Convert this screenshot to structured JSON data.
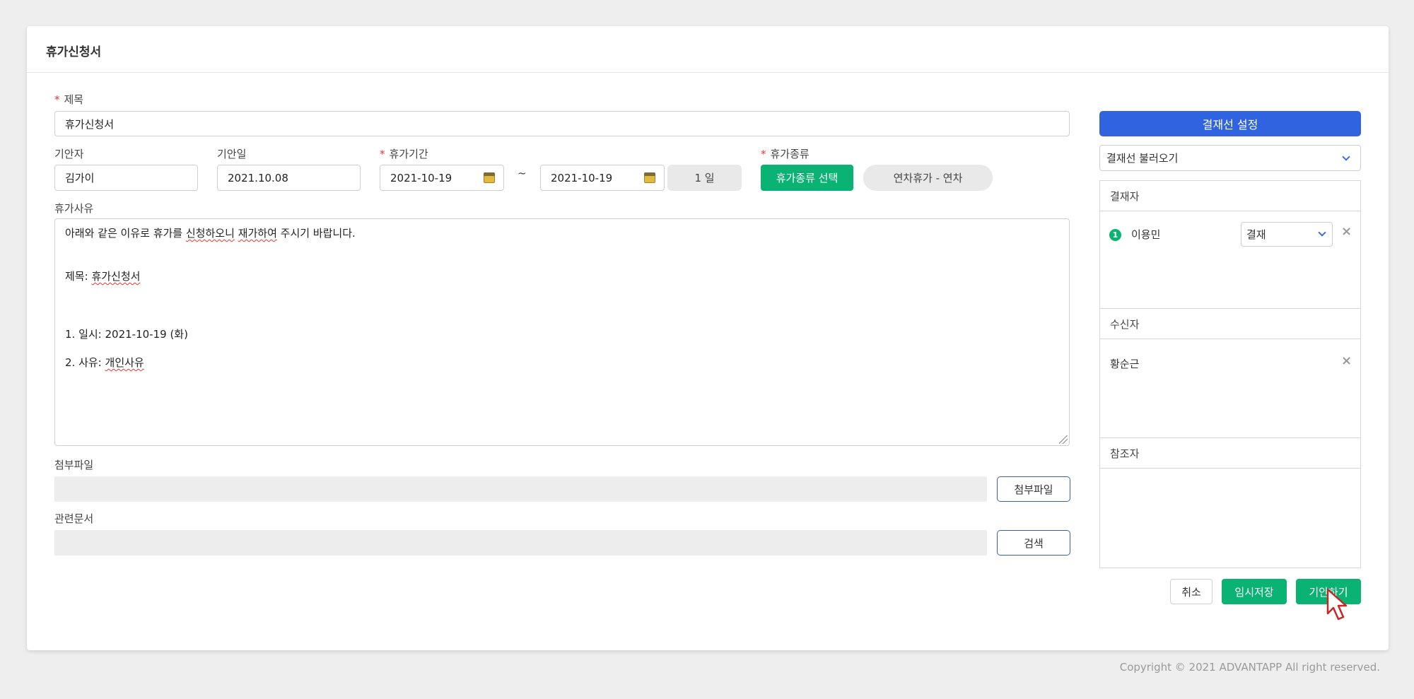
{
  "form": {
    "window_title": "휴가신청서",
    "title_label": "제목",
    "title_value": "휴가신청서",
    "drafter_label": "기안자",
    "drafter_value": "김가이",
    "draft_date_label": "기안일",
    "draft_date_value": "2021.10.08",
    "period_label": "휴가기간",
    "period_start": "2021-10-19",
    "period_tilde": "~",
    "period_end": "2021-10-19",
    "period_days": "1 일",
    "type_label": "휴가종류",
    "type_select_button": "휴가종류 선택",
    "type_value": "연차휴가 - 연차",
    "reason_label": "휴가사유",
    "reason_lines": {
      "l1_a": "아래와 같은 이유로 휴가를 ",
      "l1_b": "신청하오니",
      "l1_c": " ",
      "l1_d": "재가하여",
      "l1_e": " 주시기 바랍니다.",
      "l2_a": "제목: ",
      "l2_b": "휴가신청서",
      "l3": "1. 일시: 2021-10-19 (화)",
      "l4_a": "2. 사유: ",
      "l4_b": "개인사유"
    },
    "attachment_label": "첨부파일",
    "attachment_button": "첨부파일",
    "related_doc_label": "관련문서",
    "related_doc_button": "검색"
  },
  "approval": {
    "set_line_button": "결재선 설정",
    "load_line_placeholder": "결재선 불러오기",
    "approver_header": "결재자",
    "approvers": [
      {
        "order": "1",
        "name": "이용민",
        "role": "결재"
      }
    ],
    "receiver_header": "수신자",
    "receivers": [
      {
        "name": "황순근"
      }
    ],
    "reference_header": "참조자",
    "close_glyph": "×"
  },
  "actions": {
    "cancel": "취소",
    "temp_save": "임시저장",
    "submit": "기안하기"
  },
  "footer": {
    "copyright": "Copyright © 2021 ADVANTAPP All right reserved."
  },
  "colors": {
    "primary_blue": "#2f63e0",
    "green": "#0ab373",
    "required_red": "#e53935"
  }
}
